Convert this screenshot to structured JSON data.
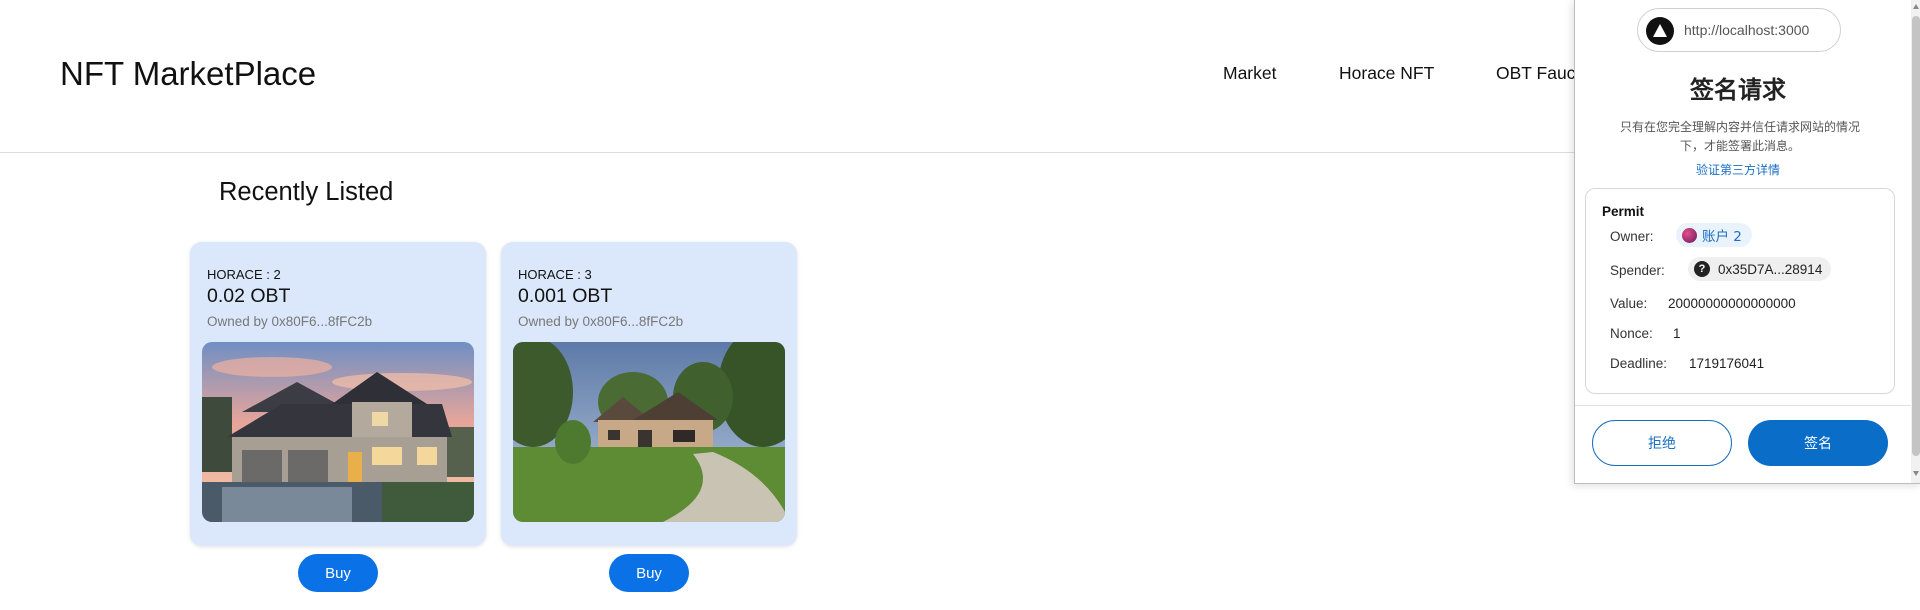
{
  "site": {
    "brand": "NFT MarketPlace",
    "nav": [
      "Market",
      "Horace NFT",
      "OBT Fauc"
    ],
    "section_title": "Recently Listed"
  },
  "cards": [
    {
      "name": "HORACE : 2",
      "price": "0.02 OBT",
      "owner": "Owned by 0x80F6...8fFC2b",
      "buy_label": "Buy"
    },
    {
      "name": "HORACE : 3",
      "price": "0.001 OBT",
      "owner": "Owned by 0x80F6...8fFC2b",
      "buy_label": "Buy"
    }
  ],
  "wallet": {
    "origin_url": "http://localhost:3000",
    "title": "签名请求",
    "warning": "只有在您完全理解内容并信任请求网站的情况下，才能签署此消息。",
    "verify_link": "验证第三方详情",
    "permit": {
      "title": "Permit",
      "owner_label": "Owner:",
      "owner_value": "账户 2",
      "spender_label": "Spender:",
      "spender_value": "0x35D7A...28914",
      "spender_icon": "?",
      "value_label": "Value:",
      "value_value": "20000000000000000",
      "nonce_label": "Nonce:",
      "nonce_value": "1",
      "deadline_label": "Deadline:",
      "deadline_value": "1719176041"
    },
    "reject_label": "拒绝",
    "sign_label": "签名"
  },
  "colors": {
    "accent": "#0a72e6",
    "card_bg": "#dbe8fb",
    "link": "#1a6fc2"
  }
}
